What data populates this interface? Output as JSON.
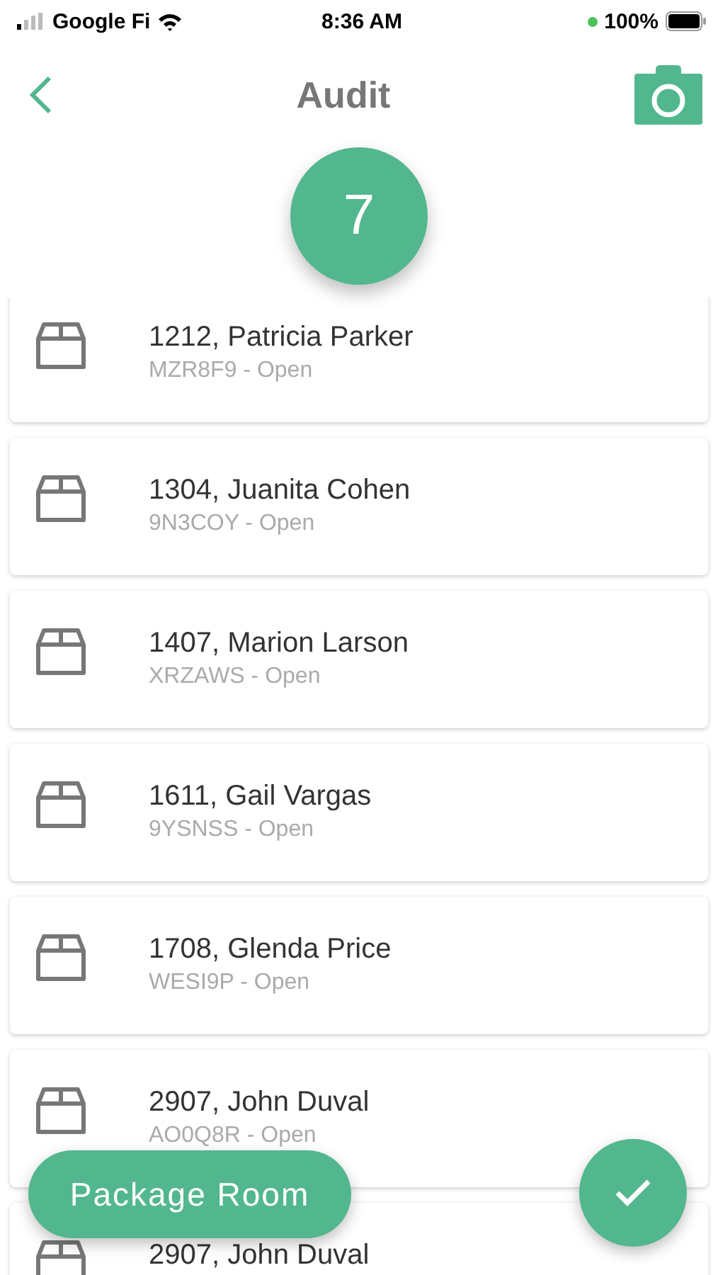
{
  "status_bar": {
    "carrier": "Google Fi",
    "time": "8:36 AM",
    "battery": "100%"
  },
  "header": {
    "title": "Audit"
  },
  "count": "7",
  "packages": [
    {
      "title": "1212, Patricia Parker",
      "subtitle": "MZR8F9 - Open"
    },
    {
      "title": "1304, Juanita Cohen",
      "subtitle": "9N3COY - Open"
    },
    {
      "title": "1407, Marion Larson",
      "subtitle": "XRZAWS - Open"
    },
    {
      "title": "1611, Gail Vargas",
      "subtitle": "9YSNSS - Open"
    },
    {
      "title": "1708, Glenda Price",
      "subtitle": "WESI9P - Open"
    },
    {
      "title": "2907, John Duval",
      "subtitle": "AO0Q8R - Open"
    },
    {
      "title": "2907, John Duval"
    }
  ],
  "location_button": "Package Room"
}
